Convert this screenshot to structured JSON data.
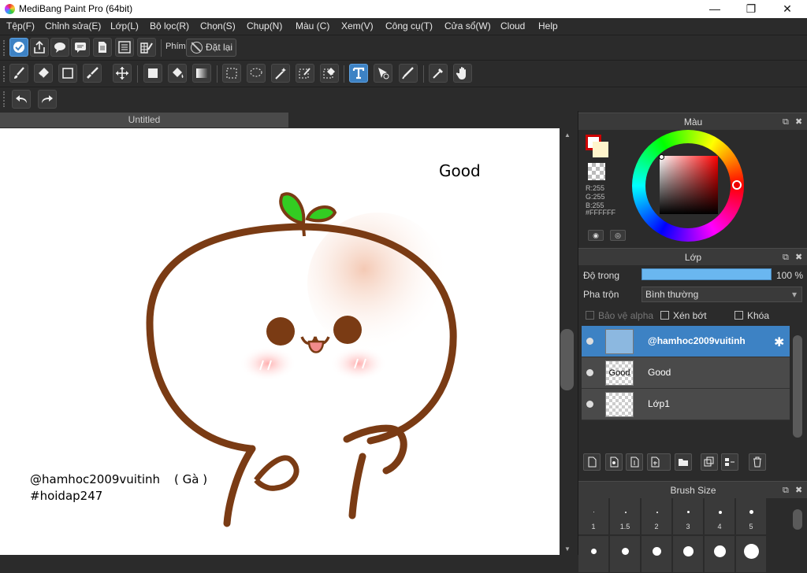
{
  "window": {
    "title": "MediBang Paint Pro (64bit)",
    "minimize": "—",
    "maximize": "❐",
    "close": "✕"
  },
  "menu": [
    "Tệp(F)",
    "Chỉnh sửa(E)",
    "Lớp(L)",
    "Bộ lọc(R)",
    "Chọn(S)",
    "Chụp(N)",
    "Màu (C)",
    "Xem(V)",
    "Công cụ(T)",
    "Cửa sổ(W)",
    "Cloud",
    "Help"
  ],
  "toolbar1": {
    "key_label": "Phím",
    "reset_label": "Đặt lại"
  },
  "document": {
    "tab_title": "Untitled"
  },
  "canvas": {
    "text_good": "Good",
    "credit_handle": "@hamhoc2009vuitinh",
    "credit_note": "( Gà )",
    "hashtag": "#hoidap247"
  },
  "color_panel": {
    "title": "Màu",
    "foreground": "#FFFFFF",
    "rgb": {
      "r": "R:255",
      "g": "G:255",
      "b": "B:255",
      "hex": "#FFFFFF"
    }
  },
  "layer_panel": {
    "title": "Lớp",
    "opacity_label": "Độ trong",
    "opacity_value": "100 %",
    "opacity": 1.0,
    "blend_label": "Pha trộn",
    "blend_value": "Bình thường",
    "protect_alpha": "Bảo vệ alpha",
    "clipping": "Xén bớt",
    "lock": "Khóa",
    "layers": [
      {
        "name": "@hamhoc2009vuitinh",
        "selected": true
      },
      {
        "name": "Good",
        "selected": false
      },
      {
        "name": "Lớp1",
        "selected": false
      }
    ]
  },
  "brush_panel": {
    "title": "Brush Size",
    "sizes": [
      "1",
      "1.5",
      "2",
      "3",
      "4",
      "5"
    ]
  },
  "colors": {
    "accent": "#3d82c4",
    "panel": "#2b2b2b",
    "stroke": "#7a3b14",
    "sprout": "#33cc22"
  }
}
